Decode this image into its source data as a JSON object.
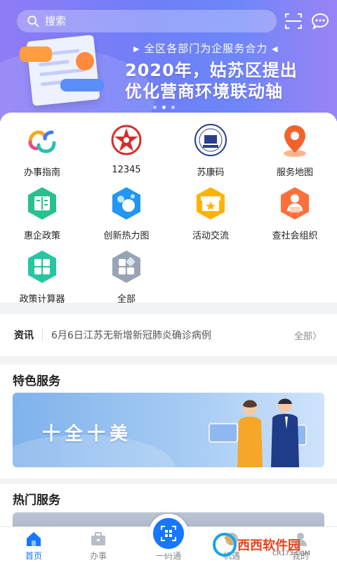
{
  "search": {
    "placeholder": "搜索"
  },
  "header_icons": {
    "scan": "scan-icon",
    "message": "message-icon"
  },
  "banner": {
    "subtitle": "全区各部门为企服务合力",
    "line1": "2020年，姑苏区提出",
    "line2": "优化营商环境联动轴",
    "dots": 3,
    "active_dot": 1
  },
  "grid": [
    {
      "label": "办事指南",
      "icon": "guide-icon"
    },
    {
      "label": "12345",
      "icon": "hotline-12345-icon"
    },
    {
      "label": "苏康码",
      "icon": "sukang-code-icon"
    },
    {
      "label": "服务地图",
      "icon": "map-pin-icon"
    },
    {
      "label": "惠企政策",
      "icon": "policy-book-icon"
    },
    {
      "label": "创新热力图",
      "icon": "heatmap-icon"
    },
    {
      "label": "活动交流",
      "icon": "gift-activity-icon"
    },
    {
      "label": "查社会组织",
      "icon": "organization-icon"
    },
    {
      "label": "政策计算器",
      "icon": "calculator-icon"
    },
    {
      "label": "全部",
      "icon": "all-apps-icon"
    }
  ],
  "news": {
    "tag": "资讯",
    "headline": "6月6日江苏无新增新冠肺炎确诊病例",
    "more": "全部"
  },
  "special": {
    "title": "特色服务",
    "banner_text": "十全十美"
  },
  "hot": {
    "title": "热门服务"
  },
  "tabs": [
    {
      "label": "首页",
      "active": true
    },
    {
      "label": "办事",
      "active": false
    },
    {
      "label": "一码通",
      "active": false
    },
    {
      "label": "机遇",
      "active": false
    },
    {
      "label": "我的",
      "active": false
    }
  ],
  "watermark": {
    "text": "西西软件园",
    "sub": "CR173.COM"
  },
  "colors": {
    "accent": "#1677ff",
    "banner_start": "#8e7cf6",
    "banner_end": "#6d86f8"
  }
}
